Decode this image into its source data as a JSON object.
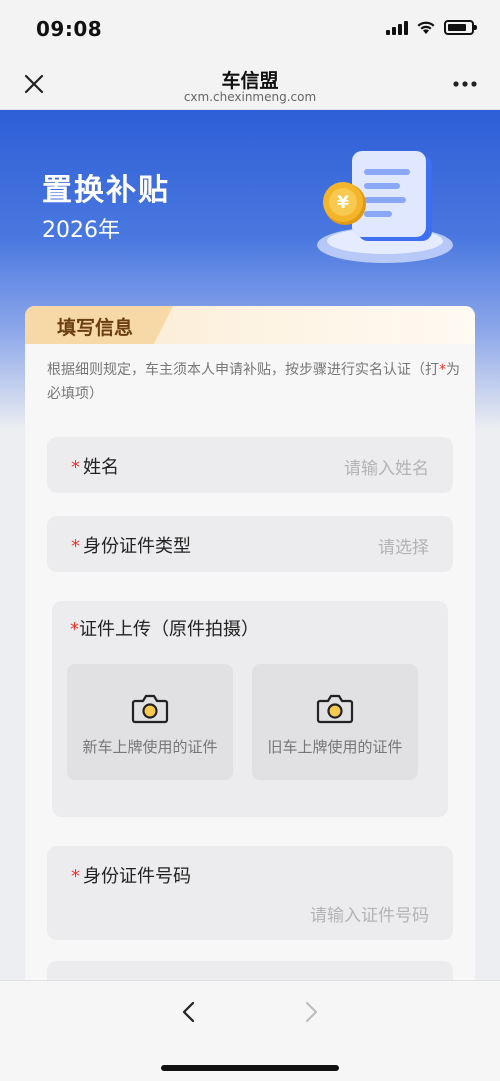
{
  "status_bar": {
    "time": "09:08",
    "battery_level": 0.8
  },
  "nav": {
    "title": "车信盟",
    "subtitle": "cxm.chexinmeng.com",
    "close_icon": "close-icon",
    "more_icon": "more-icon"
  },
  "banner": {
    "title": "置换补贴",
    "year": "2026年",
    "coin_symbol": "¥"
  },
  "form": {
    "tab_label": "填写信息",
    "description_prefix": "根据细则规定，车主须本人申请补贴，按步骤进行实名认证（打",
    "description_mark": "*",
    "description_suffix": "为必填项）",
    "required_mark": "*",
    "name": {
      "label": "姓名",
      "placeholder": "请输入姓名"
    },
    "id_type": {
      "label": "身份证件类型",
      "placeholder": "请选择"
    },
    "upload": {
      "label": "证件上传（原件拍摄）",
      "tiles": [
        {
          "label": "新车上牌使用的证件",
          "icon": "camera-icon"
        },
        {
          "label": "旧车上牌使用的证件",
          "icon": "camera-icon"
        }
      ]
    },
    "id_number": {
      "label": "身份证件号码",
      "placeholder": "请输入证件号码"
    }
  },
  "colors": {
    "accent_blue": "#2e5fd6",
    "required_red": "#e8372c",
    "tab_brown": "#6b3d12",
    "coin_gold": "#f4b52a"
  }
}
